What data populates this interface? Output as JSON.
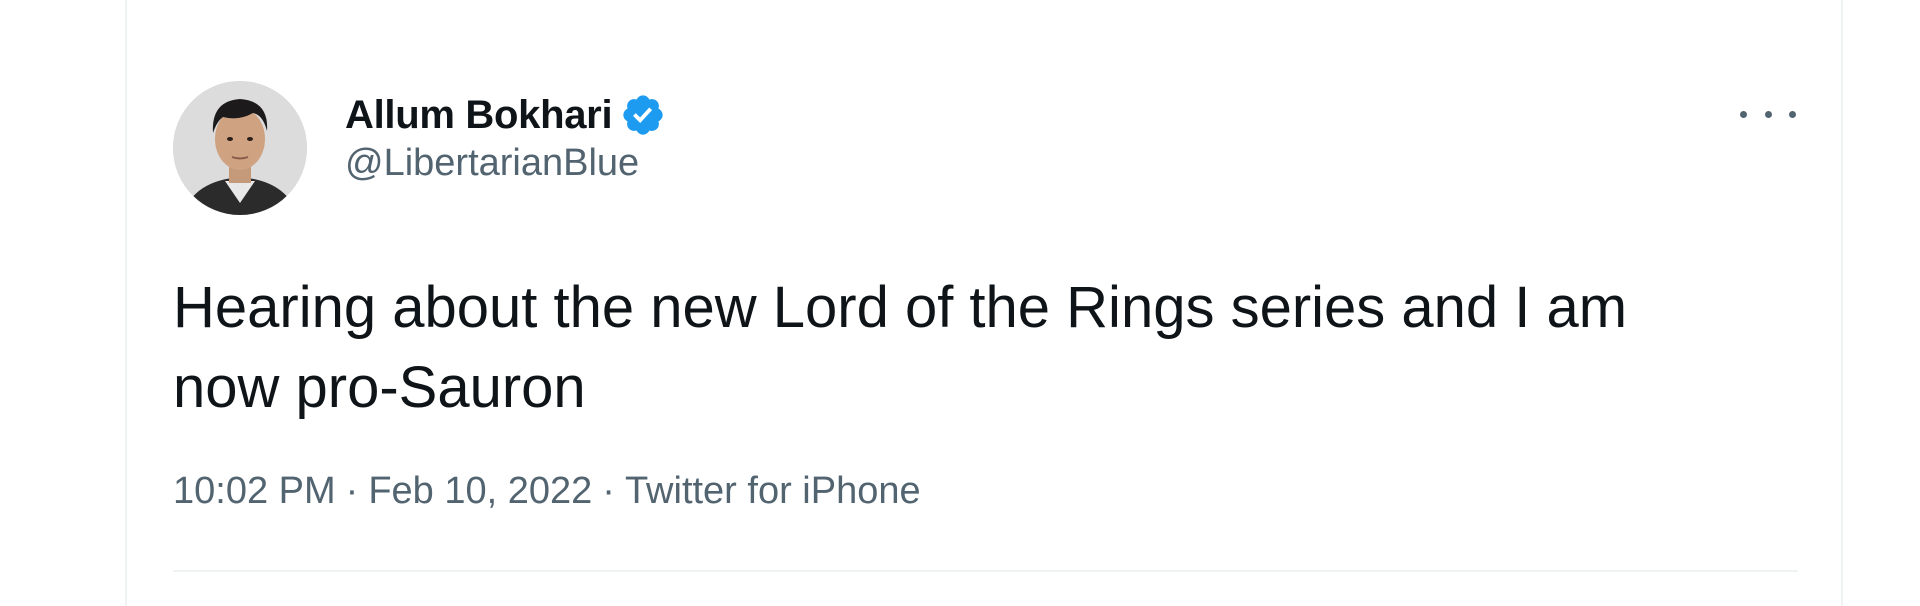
{
  "tweet": {
    "author": {
      "display_name": "Allum Bokhari",
      "handle": "@LibertarianBlue",
      "verified": true
    },
    "text": "Hearing about the new Lord of the Rings series and I am now pro-Sauron",
    "time": "10:02 PM",
    "date": "Feb 10, 2022",
    "source": "Twitter for iPhone",
    "separator": "·"
  },
  "icons": {
    "verified": "verified-badge-icon",
    "more": "more-options-icon"
  },
  "colors": {
    "text_primary": "#0f1419",
    "text_secondary": "#536471",
    "verified_blue": "#1d9bf0",
    "border": "#eff3f4"
  }
}
